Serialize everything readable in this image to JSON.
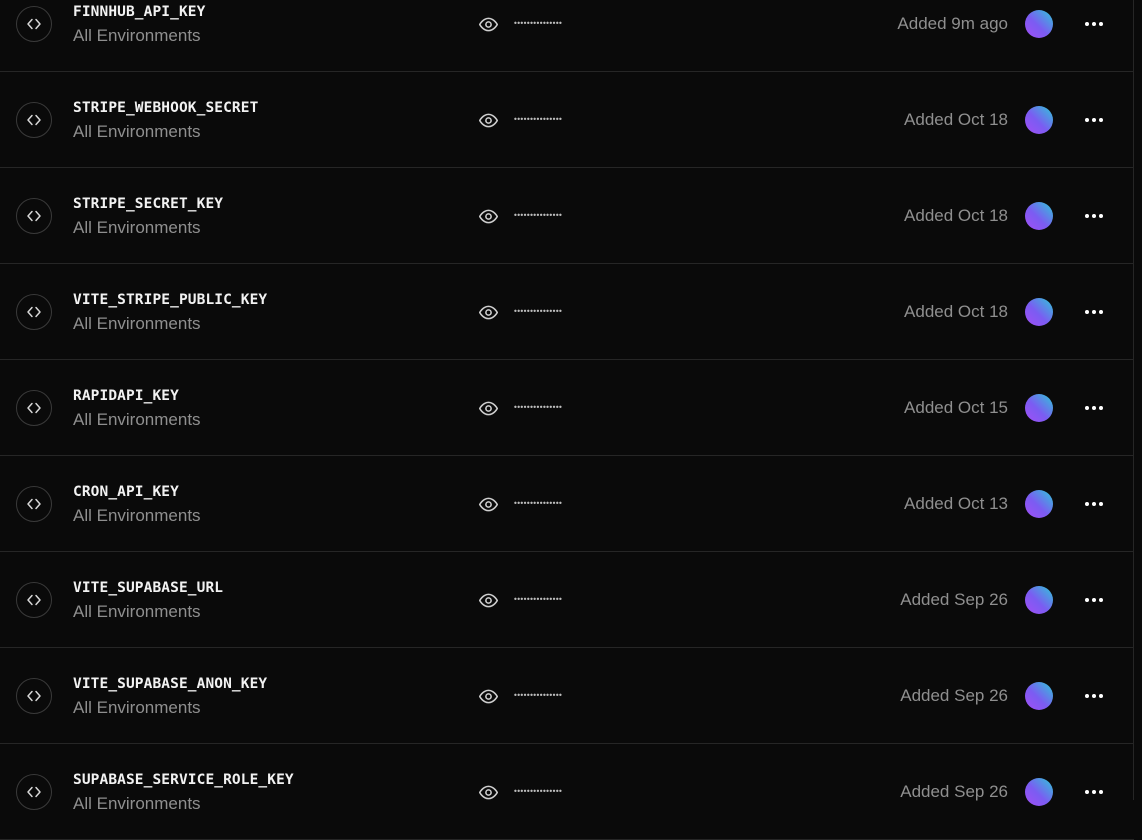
{
  "variables": [
    {
      "name": "FINNHUB_API_KEY",
      "environment": "All Environments",
      "masked_value": "•••••••••••••••",
      "added": "Added 9m ago"
    },
    {
      "name": "STRIPE_WEBHOOK_SECRET",
      "environment": "All Environments",
      "masked_value": "•••••••••••••••",
      "added": "Added Oct 18"
    },
    {
      "name": "STRIPE_SECRET_KEY",
      "environment": "All Environments",
      "masked_value": "•••••••••••••••",
      "added": "Added Oct 18"
    },
    {
      "name": "VITE_STRIPE_PUBLIC_KEY",
      "environment": "All Environments",
      "masked_value": "•••••••••••••••",
      "added": "Added Oct 18"
    },
    {
      "name": "RAPIDAPI_KEY",
      "environment": "All Environments",
      "masked_value": "•••••••••••••••",
      "added": "Added Oct 15"
    },
    {
      "name": "CRON_API_KEY",
      "environment": "All Environments",
      "masked_value": "•••••••••••••••",
      "added": "Added Oct 13"
    },
    {
      "name": "VITE_SUPABASE_URL",
      "environment": "All Environments",
      "masked_value": "•••••••••••••••",
      "added": "Added Sep 26"
    },
    {
      "name": "VITE_SUPABASE_ANON_KEY",
      "environment": "All Environments",
      "masked_value": "•••••••••••••••",
      "added": "Added Sep 26"
    },
    {
      "name": "SUPABASE_SERVICE_ROLE_KEY",
      "environment": "All Environments",
      "masked_value": "•••••••••••••••",
      "added": "Added Sep 26"
    }
  ],
  "icons": {
    "row_icon": "code-brackets-icon",
    "reveal_icon": "eye-icon",
    "avatar": "user-avatar",
    "more": "more-horizontal-icon"
  },
  "colors": {
    "background": "#0a0a0a",
    "divider": "#262626",
    "primary_text": "#f2f2f2",
    "secondary_text": "#8f8f8f",
    "avatar_gradient": [
      "#a24ff5",
      "#7b5cf2",
      "#2ec7d8"
    ]
  }
}
